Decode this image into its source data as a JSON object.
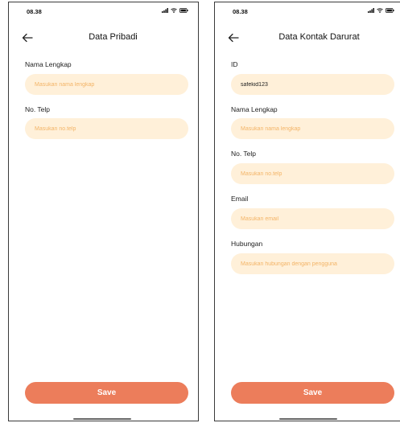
{
  "screens": [
    {
      "status_time": "08.38",
      "title": "Data Pribadi",
      "fields": [
        {
          "label": "Nama Lengkap",
          "placeholder": "Masukan nama lengkap",
          "value": ""
        },
        {
          "label": "No. Telp",
          "placeholder": "Masukan no.telp",
          "value": ""
        }
      ],
      "save_label": "Save"
    },
    {
      "status_time": "08.38",
      "title": "Data Kontak Darurat",
      "fields": [
        {
          "label": "ID",
          "placeholder": "",
          "value": "safekid123"
        },
        {
          "label": "Nama Lengkap",
          "placeholder": "Masukan nama lengkap",
          "value": ""
        },
        {
          "label": "No. Telp",
          "placeholder": "Masukan no.telp",
          "value": ""
        },
        {
          "label": "Email",
          "placeholder": "Masukan email",
          "value": ""
        },
        {
          "label": "Hubungan",
          "placeholder": "Masukan hubungan dengan pengguna",
          "value": ""
        }
      ],
      "save_label": "Save"
    }
  ],
  "icons": {
    "status": [
      "signal-icon",
      "wifi-icon",
      "battery-icon"
    ],
    "back": "back-arrow-icon"
  },
  "colors": {
    "accent": "#ec7d5b",
    "input_bg": "#fff0d9",
    "placeholder": "#f3b467"
  }
}
